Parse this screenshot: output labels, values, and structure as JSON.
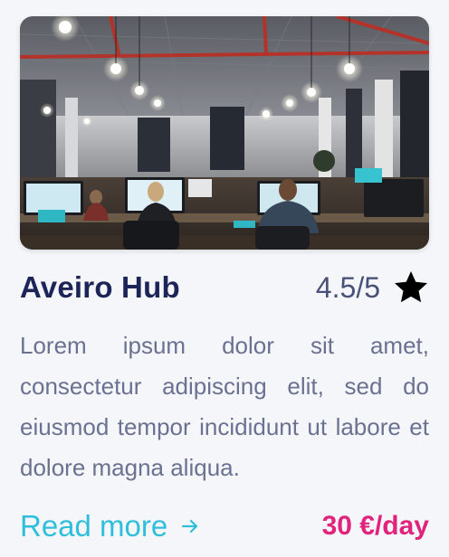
{
  "card": {
    "image": {
      "icon": "office-coworking-photo"
    },
    "title": "Aveiro Hub",
    "rating": {
      "text": "4.5/5",
      "icon": "star-icon"
    },
    "description": "Lorem ipsum dolor sit amet, consectetur adipiscing elit, sed do eiusmod tempor incididunt ut labore et dolore magna aliqua.",
    "read_more": {
      "label": "Read more",
      "icon": "arrow-right-icon"
    },
    "price": "30 €/day"
  },
  "colors": {
    "title": "#1d2458",
    "rating_text": "#4a5178",
    "description": "#6b7190",
    "link": "#2fbfdc",
    "price": "#e0237b",
    "background": "#f5f6fa"
  }
}
